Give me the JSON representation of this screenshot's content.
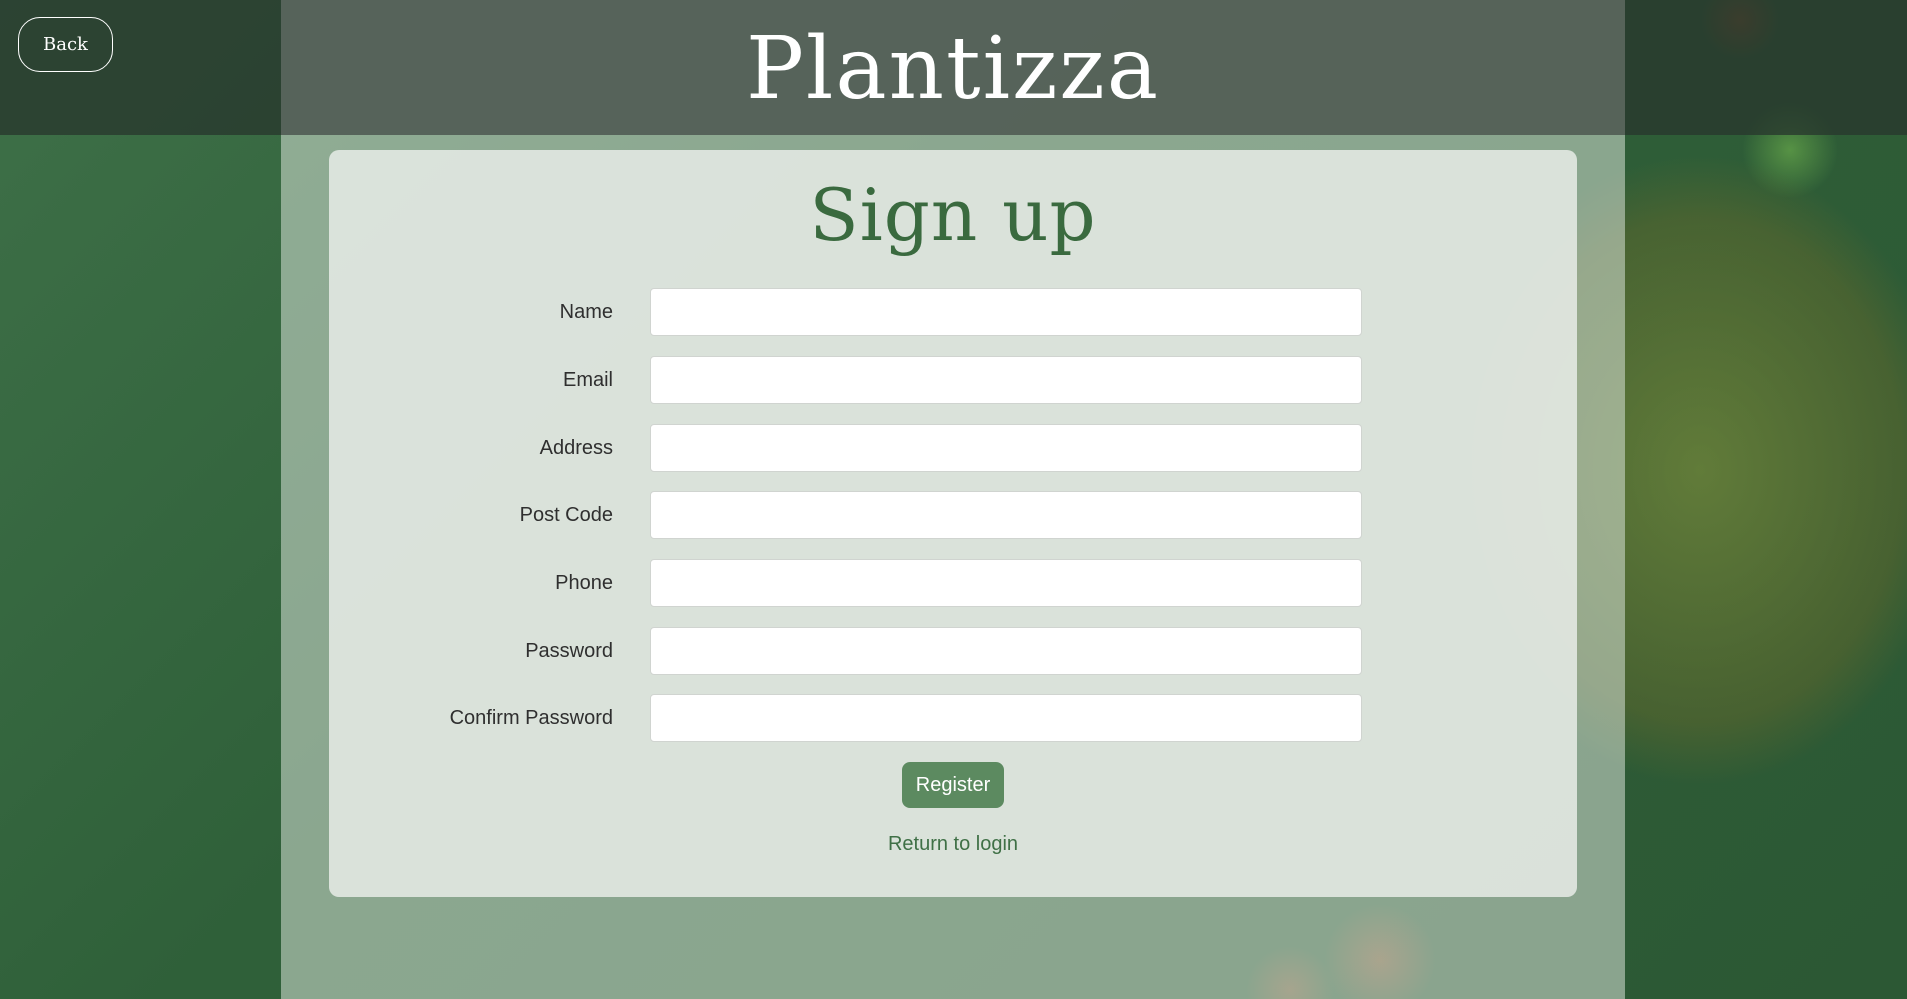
{
  "header": {
    "brand": "Plantizza",
    "back_label": "Back"
  },
  "form": {
    "title": "Sign up",
    "fields": [
      {
        "label": "Name",
        "value": "",
        "type": "text"
      },
      {
        "label": "Email",
        "value": "",
        "type": "email"
      },
      {
        "label": "Address",
        "value": "",
        "type": "text"
      },
      {
        "label": "Post Code",
        "value": "",
        "type": "text"
      },
      {
        "label": "Phone",
        "value": "",
        "type": "tel"
      },
      {
        "label": "Password",
        "value": "",
        "type": "password"
      },
      {
        "label": "Confirm Password",
        "value": "",
        "type": "password"
      }
    ],
    "submit_label": "Register",
    "login_link": "Return to login"
  },
  "colors": {
    "accent": "#5c8a60",
    "title": "#3a6a3f",
    "link": "#3f7046"
  }
}
